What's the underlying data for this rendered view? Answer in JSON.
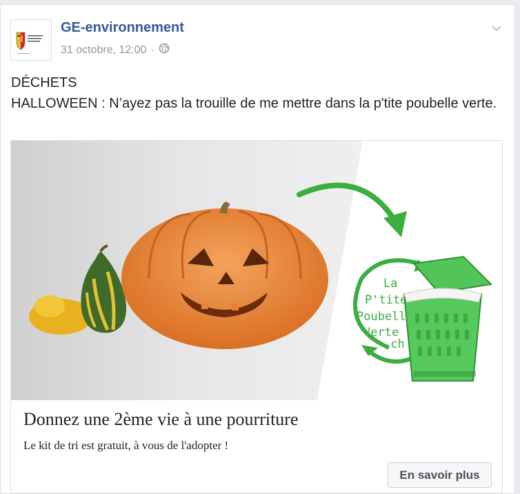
{
  "post": {
    "page_name": "GE-environnement",
    "timestamp": "31 octobre, 12:00",
    "separator": "·",
    "text_line1": "DÉCHETS",
    "text_line2": "HALLOWEEN : N’ayez pas la trouille de me mettre dans la p'tite poubelle verte."
  },
  "avatar": {
    "logo_text": "RÉPUBLIQUE ET CANTON DE GENÈVE"
  },
  "attachment": {
    "image_text_la": "La",
    "image_text_ptite": "P'tite",
    "image_text_poubelle": "Poubelle",
    "image_text_verte": "Verte",
    "image_text_ch": ".ch",
    "title": "Donnez une 2ème vie à une pourriture",
    "description": "Le kit de tri est gratuit, à vous de l'adopter !",
    "cta_label": "En savoir plus"
  },
  "icons": {
    "privacy": "globe-icon",
    "options": "chevron-down-icon"
  },
  "colors": {
    "link_blue": "#365899",
    "brand_green": "#3aae3f",
    "pumpkin": "#e8823a"
  }
}
